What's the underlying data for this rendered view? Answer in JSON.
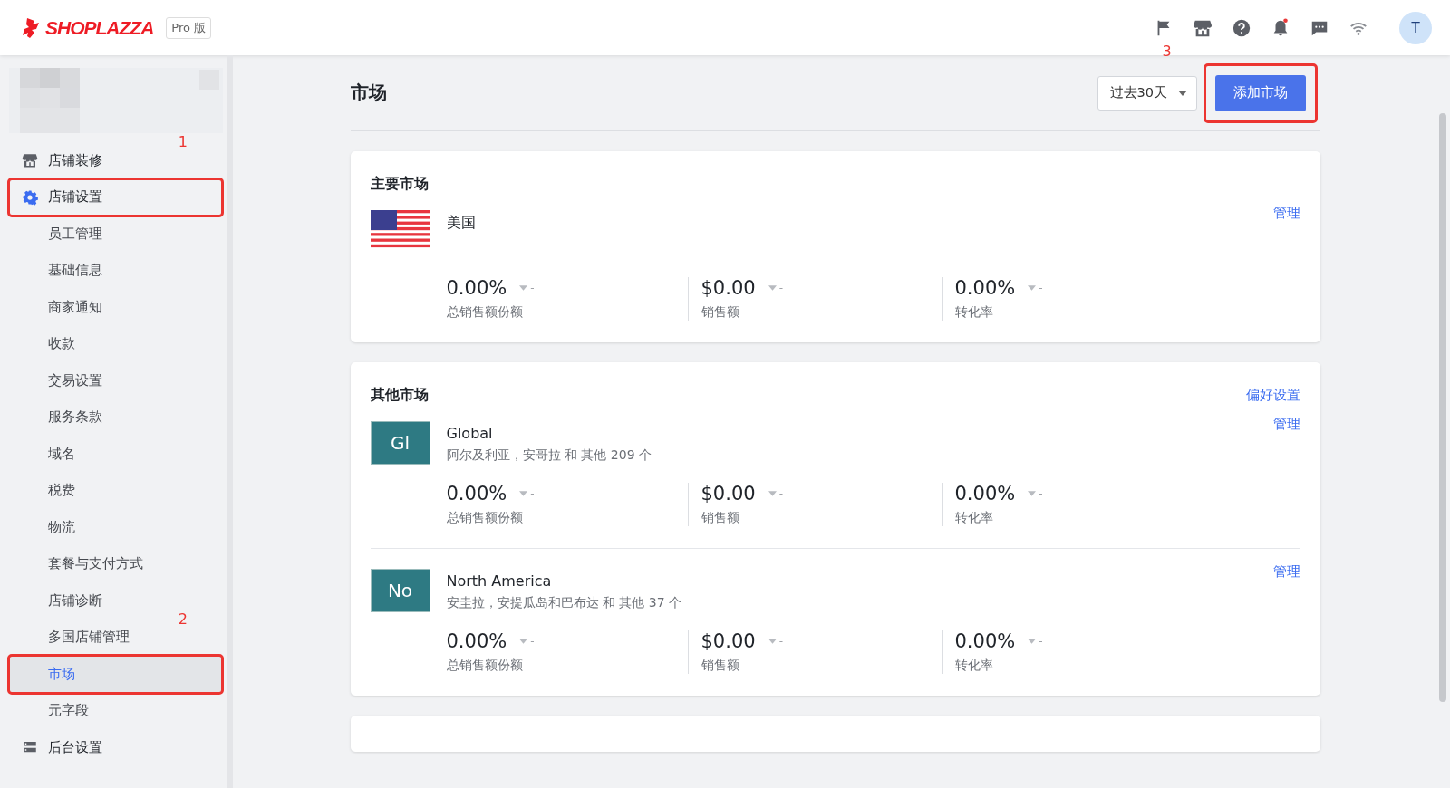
{
  "header": {
    "logo": "SHOPLAZZA",
    "plan_badge": "Pro 版",
    "avatar": "T"
  },
  "sidebar": {
    "items": [
      {
        "label": "店铺装修",
        "selected": false,
        "highlighted": false,
        "callout": "1"
      },
      {
        "label": "店铺设置",
        "selected": false,
        "highlighted": true,
        "children": [
          {
            "label": "员工管理",
            "selected": false,
            "highlighted": false
          },
          {
            "label": "基础信息",
            "selected": false,
            "highlighted": false
          },
          {
            "label": "商家通知",
            "selected": false,
            "highlighted": false
          },
          {
            "label": "收款",
            "selected": false,
            "highlighted": false
          },
          {
            "label": "交易设置",
            "selected": false,
            "highlighted": false
          },
          {
            "label": "服务条款",
            "selected": false,
            "highlighted": false
          },
          {
            "label": "域名",
            "selected": false,
            "highlighted": false
          },
          {
            "label": "税费",
            "selected": false,
            "highlighted": false
          },
          {
            "label": "物流",
            "selected": false,
            "highlighted": false
          },
          {
            "label": "套餐与支付方式",
            "selected": false,
            "highlighted": false
          },
          {
            "label": "店铺诊断",
            "selected": false,
            "highlighted": false
          },
          {
            "label": "多国店铺管理",
            "selected": false,
            "highlighted": false,
            "callout": "2"
          },
          {
            "label": "市场",
            "selected": true,
            "highlighted": true
          },
          {
            "label": "元字段",
            "selected": false,
            "highlighted": false
          }
        ]
      },
      {
        "label": "后台设置",
        "selected": false,
        "highlighted": false
      }
    ]
  },
  "page": {
    "title": "市场",
    "period_select": {
      "value": "过去30天"
    },
    "add_button": {
      "label": "添加市场",
      "highlighted": true,
      "callout": "3"
    }
  },
  "primary_market": {
    "title": "主要市场",
    "markets": [
      {
        "kind": "flag",
        "name": "美国",
        "manage": "管理",
        "stats": [
          {
            "value": "0.00%",
            "trend": "-",
            "label": "总销售额份额"
          },
          {
            "value": "$0.00",
            "trend": "-",
            "label": "销售额"
          },
          {
            "value": "0.00%",
            "trend": "-",
            "label": "转化率"
          }
        ]
      }
    ]
  },
  "other_markets": {
    "title": "其他市场",
    "action": "偏好设置",
    "markets": [
      {
        "kind": "badge",
        "badge": "Gl",
        "name": "Global",
        "regions": "阿尔及利亚，安哥拉 和 其他 209 个",
        "manage": "管理",
        "stats": [
          {
            "value": "0.00%",
            "trend": "-",
            "label": "总销售额份额"
          },
          {
            "value": "$0.00",
            "trend": "-",
            "label": "销售额"
          },
          {
            "value": "0.00%",
            "trend": "-",
            "label": "转化率"
          }
        ]
      },
      {
        "kind": "badge",
        "badge": "No",
        "name": "North America",
        "regions": "安圭拉，安提瓜岛和巴布达 和 其他 37 个",
        "manage": "管理",
        "stats": [
          {
            "value": "0.00%",
            "trend": "-",
            "label": "总销售额份额"
          },
          {
            "value": "$0.00",
            "trend": "-",
            "label": "销售额"
          },
          {
            "value": "0.00%",
            "trend": "-",
            "label": "转化率"
          }
        ]
      }
    ]
  }
}
